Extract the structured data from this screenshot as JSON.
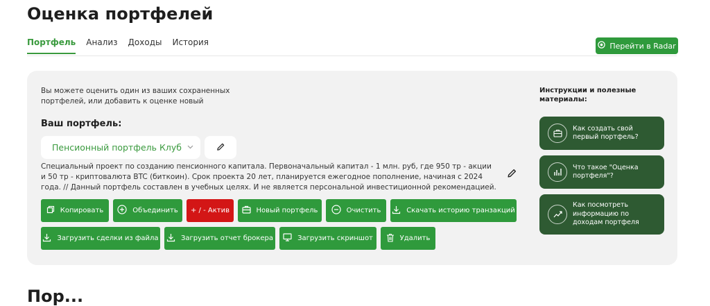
{
  "page": {
    "title": "Оценка портфелей",
    "next_section_partial": "Пор..."
  },
  "tabs": [
    {
      "label": "Портфель",
      "active": true
    },
    {
      "label": "Анализ",
      "active": false
    },
    {
      "label": "Доходы",
      "active": false
    },
    {
      "label": "История",
      "active": false
    }
  ],
  "header": {
    "radar_button_label": "Перейти в Radar"
  },
  "portfolio": {
    "intro": "Вы можете оценить один из ваших сохраненных портфелей, или добавить к оценке новый",
    "label": "Ваш портфель:",
    "selected": "Пенсионный портфель Клуб",
    "description": "Специальный проект по созданию пенсионного капитала. Первоначальный капитал - 1 млн. руб, где 950 тр - акции и 50 тр - криптовалюта BTC (биткоин). Срок проекта 20 лет, планируется ежегодное пополнение, начиная с 2024 года. // Данный портфель составлен в учебных целях. И не является персональной инвестиционной рекомендацией."
  },
  "actions": {
    "copy": "Копировать",
    "merge": "Объединить",
    "asset": "+ / - Актив",
    "new_portfolio": "Новый портфель",
    "clear": "Очистить",
    "download_history": "Скачать историю транзакций",
    "upload_trades": "Загрузить сделки из файла",
    "upload_broker": "Загрузить отчет брокера",
    "upload_screenshot": "Загрузить скриншот",
    "delete": "Удалить"
  },
  "sidebar": {
    "title": "Инструкции и полезные материалы:",
    "cards": [
      {
        "label": "Как создать свой первый портфель?",
        "icon": "briefcase-icon"
      },
      {
        "label": "Что такое \"Оценка портфеля\"?",
        "icon": "bar-chart-icon"
      },
      {
        "label": "Как посмотреть информацию по доходам портфеля",
        "icon": "line-chart-icon"
      }
    ]
  },
  "colors": {
    "accent": "#2f9a3c",
    "danger": "#d31616",
    "card": "#2e5a32",
    "panel": "#f2f2f2"
  }
}
